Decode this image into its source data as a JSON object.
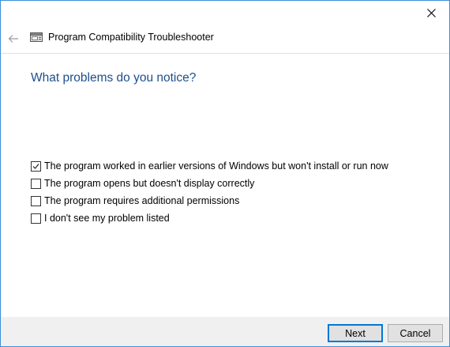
{
  "window": {
    "close_icon": "close-icon"
  },
  "header": {
    "back_icon": "back-arrow-icon",
    "app_icon": "troubleshooter-icon",
    "title": "Program Compatibility Troubleshooter"
  },
  "main": {
    "heading": "What problems do you notice?",
    "options": [
      {
        "label": "The program worked in earlier versions of Windows but won't install or run now",
        "checked": true
      },
      {
        "label": "The program opens but doesn't display correctly",
        "checked": false
      },
      {
        "label": "The program requires additional permissions",
        "checked": false
      },
      {
        "label": "I don't see my problem listed",
        "checked": false
      }
    ]
  },
  "footer": {
    "next_label": "Next",
    "cancel_label": "Cancel"
  },
  "colors": {
    "border": "#3c8fd6",
    "heading": "#1e4e8c",
    "footer_bg": "#f0f0f0",
    "default_button_border": "#0078d7"
  }
}
